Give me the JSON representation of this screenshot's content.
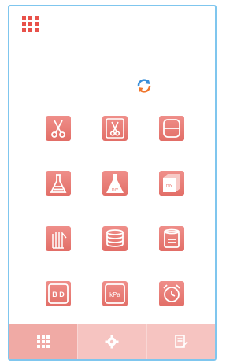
{
  "accent_color": "#e8514a",
  "tile_color": "#e8726b",
  "header": {
    "menu_icon": "grid-menu-icon"
  },
  "refresh": {
    "icon": "refresh-icon"
  },
  "tiles": [
    {
      "name": "scissors-tile",
      "icon": "scissors-icon",
      "label": ""
    },
    {
      "name": "scissors-box-tile",
      "icon": "scissors-box-icon",
      "label": ""
    },
    {
      "name": "dish-tile",
      "icon": "dish-icon",
      "label": ""
    },
    {
      "name": "flask-tile",
      "icon": "flask-icon",
      "label": ""
    },
    {
      "name": "flask-diy-tile",
      "icon": "flask-diy-icon",
      "label": "DIY"
    },
    {
      "name": "box-diy-tile",
      "icon": "box-diy-icon",
      "label": "DIY"
    },
    {
      "name": "glove-tile",
      "icon": "glove-icon",
      "label": ""
    },
    {
      "name": "stack-tile",
      "icon": "stack-icon",
      "label": ""
    },
    {
      "name": "jar-tile",
      "icon": "jar-icon",
      "label": ""
    },
    {
      "name": "bd-test-tile",
      "icon": "bd-icon",
      "label": "B D"
    },
    {
      "name": "pressure-tile",
      "icon": "kpa-icon",
      "label": "kPa"
    },
    {
      "name": "alarm-tile",
      "icon": "alarm-clock-icon",
      "label": ""
    }
  ],
  "tabs": [
    {
      "name": "tab-home",
      "icon": "grid-icon",
      "active": true
    },
    {
      "name": "tab-settings",
      "icon": "gear-icon",
      "active": false
    },
    {
      "name": "tab-records",
      "icon": "edit-document-icon",
      "active": false
    }
  ]
}
